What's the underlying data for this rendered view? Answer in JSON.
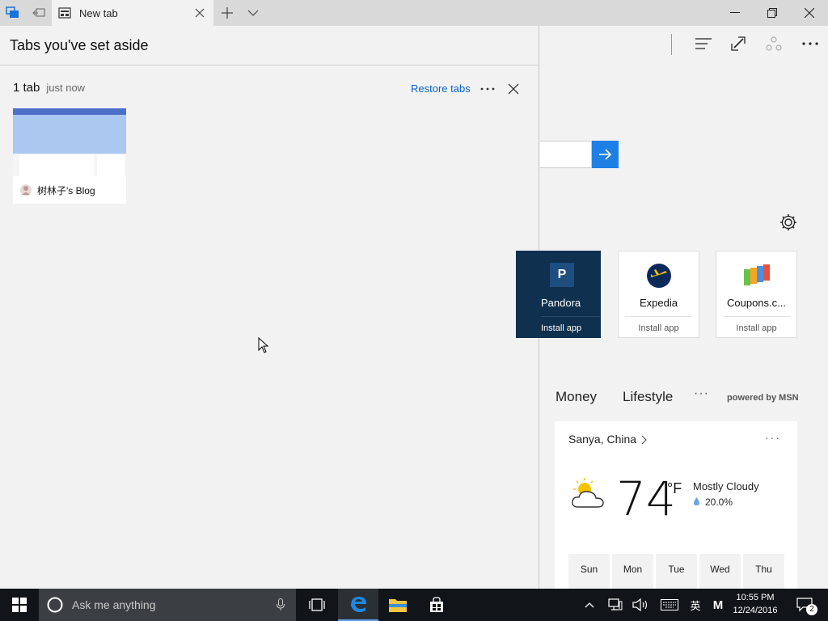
{
  "browser": {
    "tab_title": "New tab",
    "accent_color": "#0a63c9"
  },
  "aside_panel": {
    "title": "Tabs you've set aside",
    "group": {
      "count_label": "1 tab",
      "time_label": "just now",
      "restore_label": "Restore tabs",
      "tabs": [
        {
          "title": "树林子's Blog"
        }
      ]
    }
  },
  "new_tab_page": {
    "apps": [
      {
        "name": "Pandora",
        "install_label": "Install app",
        "letter": "P"
      },
      {
        "name": "Expedia",
        "install_label": "Install app"
      },
      {
        "name": "Coupons.c...",
        "install_label": "Install app"
      }
    ],
    "categories": [
      "Money",
      "Lifestyle"
    ],
    "more_label": "···",
    "powered_by": "powered by MSN",
    "weather": {
      "location": "Sanya, China",
      "temperature": "74",
      "unit": "°F",
      "condition": "Mostly Cloudy",
      "precipitation": "20.0%",
      "days": [
        "Sun",
        "Mon",
        "Tue",
        "Wed",
        "Thu"
      ]
    }
  },
  "taskbar": {
    "search_placeholder": "Ask me anything",
    "ime_label": "英",
    "ime_mode": "M",
    "time": "10:55 PM",
    "date": "12/24/2016",
    "notification_count": "2"
  }
}
